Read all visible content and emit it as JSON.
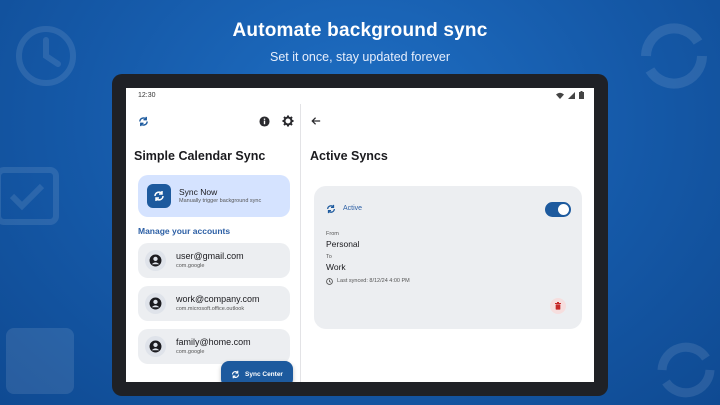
{
  "promo": {
    "title": "Automate background sync",
    "subtitle": "Set it once, stay updated forever"
  },
  "statusbar": {
    "time": "12:30"
  },
  "left_pane": {
    "app_title": "Simple Calendar Sync",
    "sync_card": {
      "label": "Sync Now",
      "sublabel": "Manually trigger background sync"
    },
    "section_label": "Manage your accounts",
    "accounts": [
      {
        "name": "user@gmail.com",
        "type": "com.google"
      },
      {
        "name": "work@company.com",
        "type": "com.microsoft.office.outlook"
      },
      {
        "name": "family@home.com",
        "type": "com.google"
      }
    ],
    "fab_label": "Sync Center"
  },
  "right_pane": {
    "title": "Active Syncs",
    "card": {
      "status": "Active",
      "toggle_on": true,
      "from_label": "From",
      "from_value": "Personal",
      "to_label": "To",
      "to_value": "Work",
      "last_synced": "Last synced: 8/12/24 4:00 PM"
    }
  },
  "colors": {
    "primary": "#1d5a9e",
    "accent_text": "#2c5fa5",
    "sync_card_bg": "#d5e3ff",
    "card_bg": "#eceef1",
    "delete": "#c62828"
  },
  "icons": {
    "app": "sync-icon",
    "info": "info-icon",
    "settings": "gear-icon",
    "back": "arrow-back-icon",
    "account": "person-icon",
    "last_synced": "clock-icon",
    "delete": "trash-icon"
  }
}
